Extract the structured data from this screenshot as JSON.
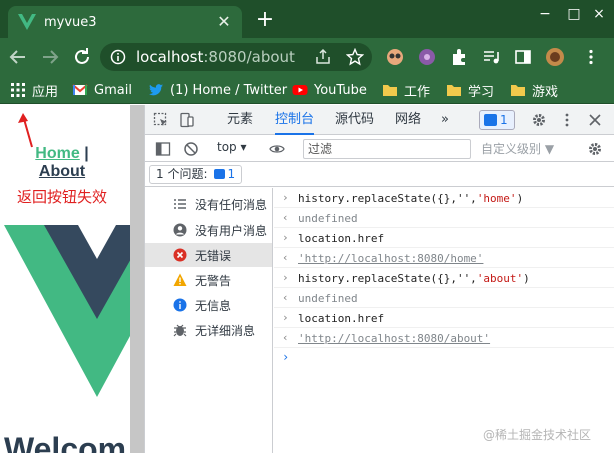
{
  "browser": {
    "tab_title": "myvue3",
    "url_host": "localhost",
    "url_path": ":8080/about",
    "new_tab_symbol": "+",
    "window_buttons": [
      "−",
      "□",
      "×"
    ]
  },
  "bookmarks": [
    {
      "label": "应用",
      "icon": "apps-grid-icon"
    },
    {
      "label": "Gmail",
      "icon": "gmail-icon"
    },
    {
      "label": "(1) Home / Twitter",
      "icon": "twitter-icon"
    },
    {
      "label": "YouTube",
      "icon": "youtube-icon"
    },
    {
      "label": "工作",
      "icon": "folder-icon"
    },
    {
      "label": "学习",
      "icon": "folder-icon"
    },
    {
      "label": "游戏",
      "icon": "folder-icon"
    }
  ],
  "page": {
    "link_home": "Home",
    "link_sep": "|",
    "link_about": "About",
    "annotation": "返回按钮失效",
    "welcome": "Welcom"
  },
  "devtools": {
    "tabs": [
      "元素",
      "控制台",
      "源代码",
      "网络"
    ],
    "active_tab": "控制台",
    "more": "»",
    "issue_count": "1",
    "context": "top ▾",
    "filter_placeholder": "过滤",
    "level": "自定义级别 ▼",
    "issues_label": "1 个问题:",
    "issues_count": "1",
    "sidebar": [
      {
        "label": "没有任何消息",
        "icon": "list-icon"
      },
      {
        "label": "没有用户消息",
        "icon": "user-icon"
      },
      {
        "label": "无错误",
        "icon": "error-icon"
      },
      {
        "label": "无警告",
        "icon": "warning-icon"
      },
      {
        "label": "无信息",
        "icon": "info-icon"
      },
      {
        "label": "无详细消息",
        "icon": "bug-icon"
      }
    ],
    "console": [
      {
        "kind": "in",
        "text_pre": "history.replaceState({},'',",
        "text_str": "'home'",
        "text_post": ")"
      },
      {
        "kind": "out",
        "text": "undefined"
      },
      {
        "kind": "in",
        "text": "location.href"
      },
      {
        "kind": "out",
        "text_link": "'http://localhost:8080/home'"
      },
      {
        "kind": "in",
        "text_pre": "history.replaceState({},'',",
        "text_str": "'about'",
        "text_post": ")"
      },
      {
        "kind": "out",
        "text": "undefined"
      },
      {
        "kind": "in",
        "text": "location.href"
      },
      {
        "kind": "out",
        "text_link": "'http://localhost:8080/about'"
      }
    ],
    "prompt": "›"
  },
  "watermark": "@稀土掘金技术社区",
  "colors": {
    "chrome_dark": "#1f4f2a",
    "chrome_tab": "#2d6a3c",
    "vue_green": "#42b983",
    "vue_dark": "#35495e",
    "accent_blue": "#1a73e8",
    "annotation_red": "#e02020"
  }
}
